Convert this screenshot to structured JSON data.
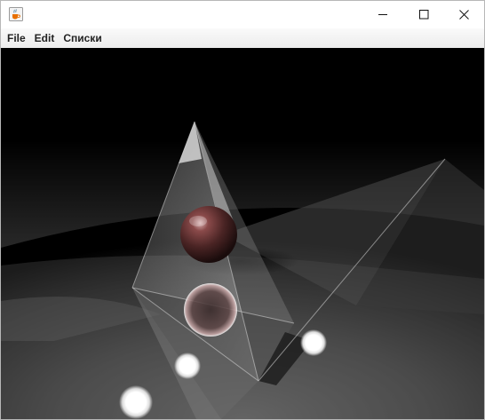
{
  "window": {
    "title": "",
    "app_icon": "java-coffee-cup-icon",
    "controls": [
      "minimize-icon",
      "maximize-icon",
      "close-icon"
    ]
  },
  "menu": {
    "items": [
      {
        "label": "File"
      },
      {
        "label": "Edit"
      },
      {
        "label": "Списки"
      }
    ]
  },
  "scene": {
    "objects": [
      "glass-pyramid",
      "red-sphere",
      "white-light-spheres",
      "gray-floor"
    ],
    "background": "#000000",
    "floor_color": "#4a4a4a",
    "sphere_color": "#5a2e2e",
    "light_color": "#ffffff"
  }
}
